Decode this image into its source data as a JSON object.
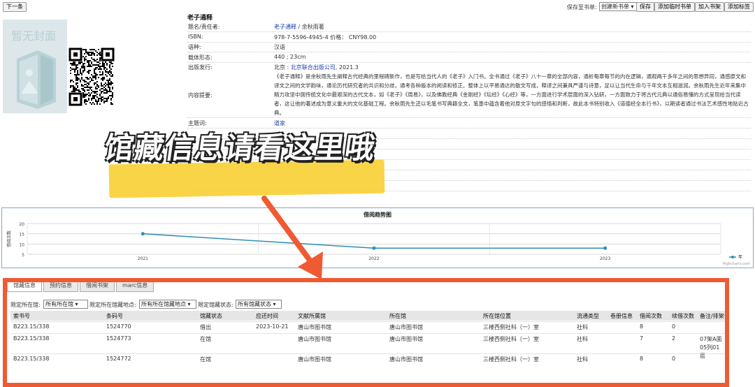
{
  "toolbar": {
    "back_label": "下一条",
    "save_to_shelf_label": "保存至书单:",
    "shelf_select": "创建新书单",
    "save_label": "保存",
    "add_temp_shelf_label": "添加临时书单",
    "add_bookshelf_label": "加入书架",
    "add_tag_label": "添加标签"
  },
  "cover": {
    "placeholder": "暂无封面"
  },
  "book": {
    "title": "老子通释",
    "fields": {
      "author_label": "题名/责任者:",
      "author_title_link": "老子通释",
      "author_rest": " / 余秋雨著",
      "isbn_label": "ISBN:",
      "isbn_value": "978-7-5596-4945-4 价格： CNY98.00",
      "language_label": "语种:",
      "language_value": "汉语",
      "form_label": "载体形态:",
      "form_value": "440 ; 23cm",
      "publisher_label": "出版发行:",
      "publisher_prefix": "北京 : ",
      "publisher_link": "北京联合出版公司",
      "publisher_year": ", 2021.3",
      "summary_label": "内容提要:",
      "summary_value": "《老子通释》是余秋雨先生阐释古代经典的里程碑新作，也是写给当代人的《老子》入门书。全书通过《老子》八十一章的全部内容，通析每章每节的内在逻辑，通观两千多年之间的思想异同，通感原文和译文之间的文学韵味，通论历代研究者的共识和分歧，通考各种版本的阅读和修正。整体上以平易通达的散文写成，释译之间兼具严谨与诗意，足以让当代生命与千年文本互相滋润。余秋雨先生近年来集中精力攻坚中国传统文化中最艰深的古代文本，如《老子》《周易》，以及佛教经典《金刚经》《坛经》《心经》等，一方面进行学术层面的深入钻研，一方面致力于将古代元典以通俗易懂的方式呈现给当代读者，这让他的著述成为意义重大的文化基础工程。余秋雨先生还以毛笔书写典籍全文，笔墨中蕴含着他对原文字句的感悟和判断，故此本书特别收入《道德经全本行书》，以期读者通过书法艺术感性地贴近古典。",
      "subject_label": "主题词:",
      "subject_link": "道家"
    }
  },
  "overlay_text": "馆藏信息请看这里哦",
  "chart_data": {
    "type": "line",
    "title": "借阅趋势图",
    "ylabel": "借阅次数",
    "xlabel": "",
    "categories": [
      "2021",
      "2022",
      "2023"
    ],
    "series": [
      {
        "name": "年",
        "values": [
          15,
          8,
          8
        ]
      }
    ],
    "ylim": [
      5,
      20
    ],
    "yticks": [
      "20",
      "15",
      "10",
      "5"
    ],
    "credit": "Highcharts.com",
    "color": "#2f8fb0"
  },
  "tabs": [
    {
      "label": "馆藏信息"
    },
    {
      "label": "预约信息"
    },
    {
      "label": "借阅书架"
    },
    {
      "label": "marc信息"
    }
  ],
  "filters": {
    "lib_label": "限定所在馆:",
    "lib_value": "所有所在馆",
    "loc_label": "限定所在馆藏地点:",
    "loc_value": "所有所在馆藏地点",
    "status_label": "限定馆藏状态:",
    "status_value": "所有馆藏状态"
  },
  "holdings": {
    "headers": [
      "索书号",
      "条码号",
      "馆藏状态",
      "应还时间",
      "文献所属馆",
      "所在馆",
      "所在馆位置",
      "流通类型",
      "卷册信息",
      "借阅次数",
      "续借次数",
      "备注/排架号"
    ],
    "rows": [
      [
        "B223.15/338",
        "1524770",
        "借出",
        "2023-10-21",
        "唐山市图书馆",
        "唐山市图书馆",
        "三楼西侧社科（一）室",
        "社科",
        "",
        "8",
        "0",
        ""
      ],
      [
        "B223.15/338",
        "1524773",
        "在馆",
        "",
        "唐山市图书馆",
        "唐山市图书馆",
        "三楼西侧社科（一）室",
        "社科",
        "",
        "7",
        "2",
        "07架A面05列01层"
      ],
      [
        "B223.15/338",
        "1524772",
        "在馆",
        "",
        "唐山市图书馆",
        "唐山市图书馆",
        "三楼西侧社科（一）室",
        "社科",
        "",
        "8",
        "0",
        ""
      ]
    ]
  },
  "colors": {
    "accent_orange": "#ef5a32",
    "highlight_yellow": "#f8cf32",
    "link_blue": "#1a3fa8"
  }
}
